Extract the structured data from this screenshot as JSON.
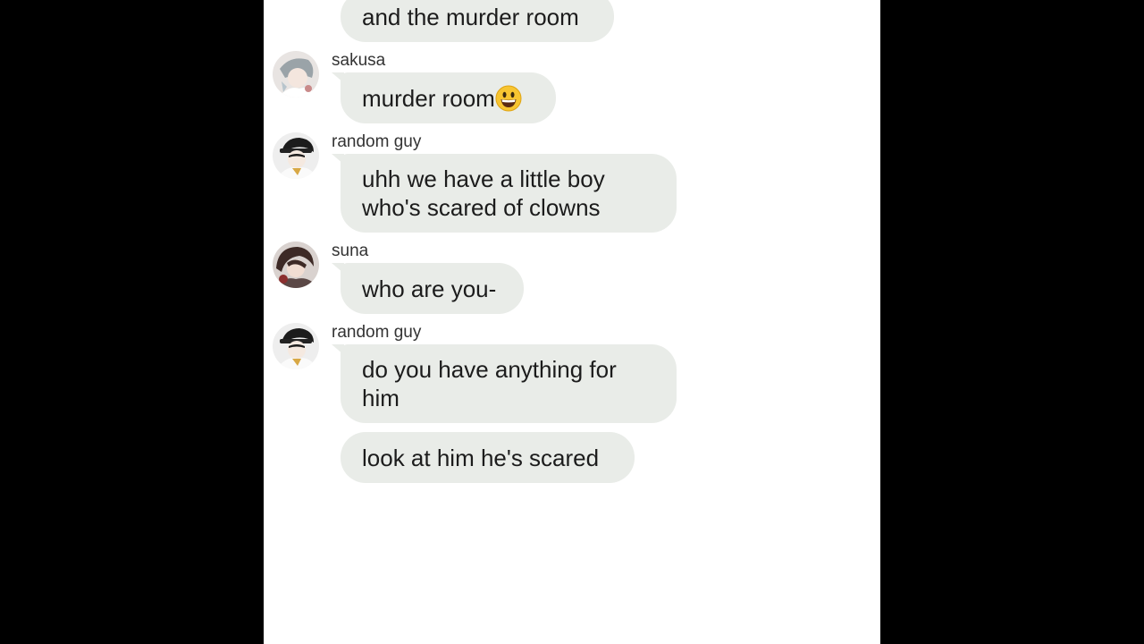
{
  "chat": {
    "messages": [
      {
        "text": "and the murder room"
      },
      {
        "sender": "sakusa",
        "text": "murder room",
        "emoji": "grinning-face-emoji"
      },
      {
        "sender": "random guy",
        "lines": [
          "uhh we have a little boy",
          "who's scared of clowns"
        ]
      },
      {
        "sender": "suna",
        "text": "who are you-"
      },
      {
        "sender": "random guy",
        "lines": [
          "do you have anything for",
          "him"
        ]
      },
      {
        "text": "look at him he's scared"
      }
    ]
  },
  "colors": {
    "bubble": "#e9ece8",
    "background": "#ffffff",
    "letterbox": "#000000",
    "text": "#1c1c1c"
  }
}
